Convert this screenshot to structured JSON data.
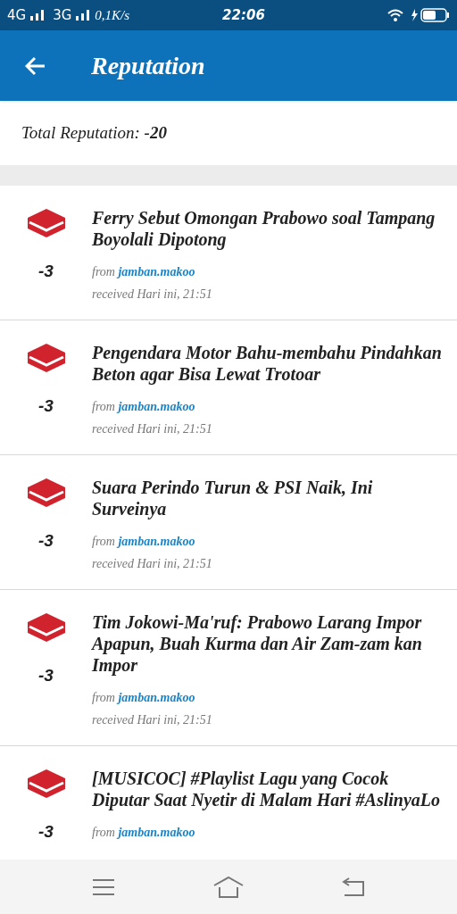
{
  "status_bar": {
    "network_1": "4G",
    "network_2": "3G",
    "speed": "0,1K/s",
    "time": "22:06"
  },
  "header": {
    "title": "Reputation"
  },
  "total": {
    "label": "Total Reputation:",
    "value": "-20"
  },
  "items": [
    {
      "title": "Ferry Sebut Omongan Prabowo soal Tampang Boyolali Dipotong",
      "points": "-3",
      "from_label": "from",
      "user": "jamban.makoo",
      "received": "received Hari ini, 21:51"
    },
    {
      "title": "Pengendara Motor Bahu-membahu Pindahkan Beton agar Bisa Lewat Trotoar",
      "points": "-3",
      "from_label": "from",
      "user": "jamban.makoo",
      "received": "received Hari ini, 21:51"
    },
    {
      "title": "Suara Perindo Turun & PSI Naik, Ini Surveinya",
      "points": "-3",
      "from_label": "from",
      "user": "jamban.makoo",
      "received": "received Hari ini, 21:51"
    },
    {
      "title": "Tim Jokowi-Ma'ruf: Prabowo Larang Impor Apapun, Buah Kurma dan Air Zam-zam kan Impor",
      "points": "-3",
      "from_label": "from",
      "user": "jamban.makoo",
      "received": "received Hari ini, 21:51"
    },
    {
      "title": "[MUSICOC] #Playlist Lagu yang Cocok Diputar Saat Nyetir di Malam Hari #AslinyaLo",
      "points": "-3",
      "from_label": "from",
      "user": "jamban.makoo"
    }
  ]
}
